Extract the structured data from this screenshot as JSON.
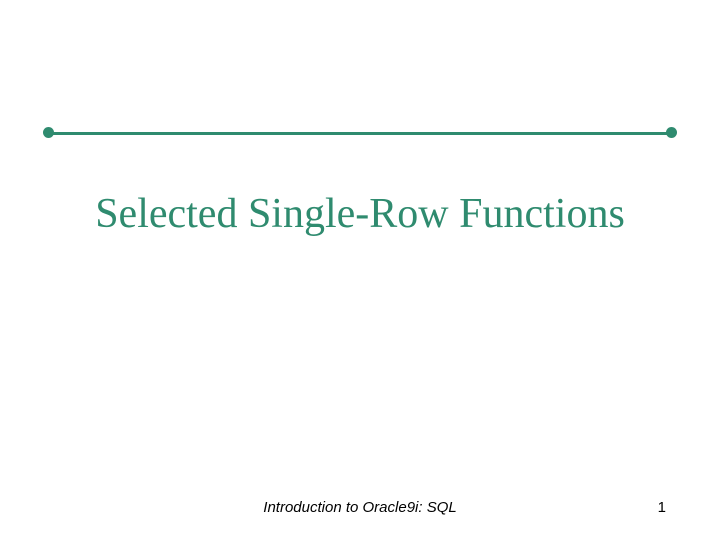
{
  "title": "Selected Single-Row Functions",
  "footer": {
    "center": "Introduction to Oracle9i: SQL",
    "page_number": "1"
  },
  "colors": {
    "accent": "#2f8b6f"
  }
}
